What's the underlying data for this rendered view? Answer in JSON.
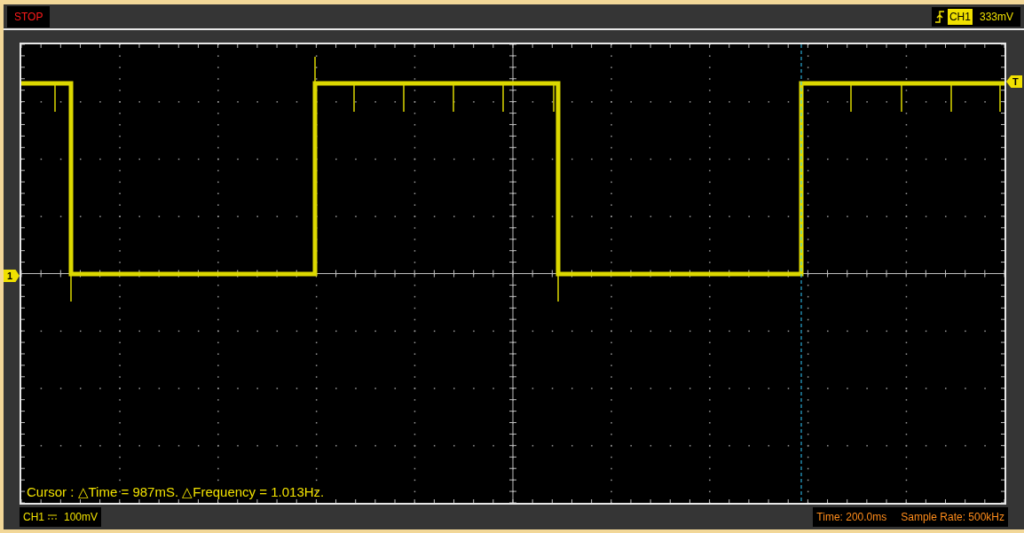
{
  "acquisition": {
    "status": "STOP"
  },
  "trigger": {
    "channel": "CH1",
    "level": "333mV",
    "marker": "T"
  },
  "plot": {
    "channel_marker": "1",
    "cursor_readout": "Cursor : △Time = 987mS. △Frequency = 1.013Hz."
  },
  "status_bar": {
    "channel": "CH1",
    "scale": "100mV",
    "time": "Time: 200.0ms",
    "sample_rate": "Sample Rate: 500kHz"
  }
}
